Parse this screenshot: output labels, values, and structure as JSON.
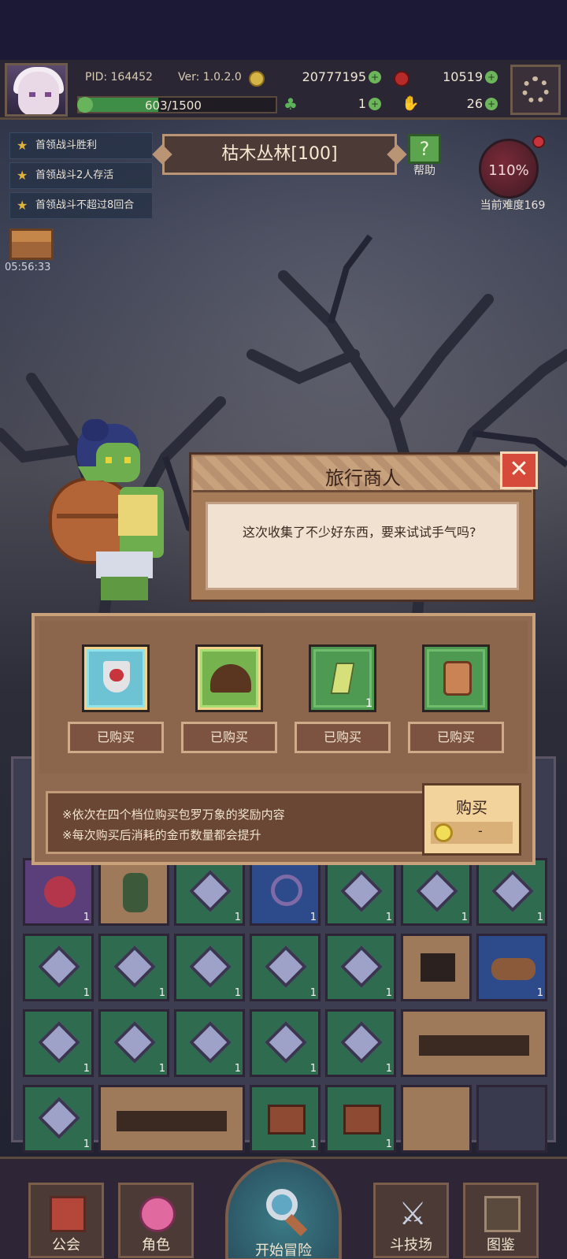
{
  "player": {
    "pid": "PID: 164452",
    "version": "Ver: 1.0.2.0",
    "hp": "603/1500",
    "hp_fraction": 0.402
  },
  "resources": {
    "gold": "20777195",
    "gems": "10519",
    "clover": "1",
    "hand": "26"
  },
  "quests": [
    "首领战斗胜利",
    "首领战斗2人存活",
    "首领战斗不超过8回合"
  ],
  "timer": "05:56:33",
  "stage": {
    "title": "枯木丛林[100]",
    "help_label": "帮助"
  },
  "difficulty": {
    "percent": "110%",
    "label": "当前难度169"
  },
  "dialog": {
    "title": "旅行商人",
    "close_icon": "✕",
    "text": "这次收集了不少好东西，要来试试手气吗?"
  },
  "shop": {
    "items": [
      {
        "icon": "heart-shield-icon",
        "badge": "",
        "status": "已购买"
      },
      {
        "icon": "helmet-icon",
        "badge": "",
        "status": "已购买"
      },
      {
        "icon": "crystal-icon",
        "badge": "1",
        "status": "已购买"
      },
      {
        "icon": "scroll-icon",
        "badge": "",
        "status": "已购买"
      }
    ],
    "notes": [
      "※依次在四个档位购买包罗万象的奖励内容",
      "※每次购买后消耗的金币数量都会提升"
    ],
    "buy_label": "购买",
    "buy_cost": "-"
  },
  "grid_counts": [
    "1",
    "1",
    "1",
    "1",
    "1",
    "1",
    "1",
    "1",
    "1",
    "1",
    "1",
    "1",
    "1",
    "1",
    "1",
    "1",
    "1",
    "1",
    "1",
    "1",
    "1",
    "1",
    "1",
    "1"
  ],
  "nav": {
    "guild": "公会",
    "character": "角色",
    "start": "开始冒险",
    "arena": "斗技场",
    "codex": "图鉴"
  },
  "colors": {
    "accent_green": "#6db55b",
    "close_red": "#d64a3c",
    "panel_brown": "#8f6a50"
  }
}
